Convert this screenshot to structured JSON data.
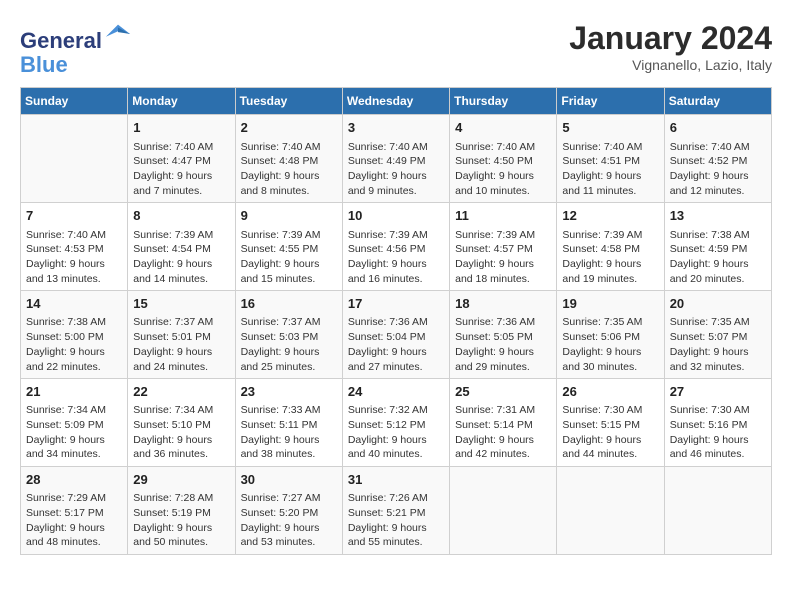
{
  "header": {
    "logo_line1": "General",
    "logo_line2": "Blue",
    "month": "January 2024",
    "location": "Vignanello, Lazio, Italy"
  },
  "weekdays": [
    "Sunday",
    "Monday",
    "Tuesday",
    "Wednesday",
    "Thursday",
    "Friday",
    "Saturday"
  ],
  "weeks": [
    [
      {
        "day": "",
        "content": ""
      },
      {
        "day": "1",
        "content": "Sunrise: 7:40 AM\nSunset: 4:47 PM\nDaylight: 9 hours\nand 7 minutes."
      },
      {
        "day": "2",
        "content": "Sunrise: 7:40 AM\nSunset: 4:48 PM\nDaylight: 9 hours\nand 8 minutes."
      },
      {
        "day": "3",
        "content": "Sunrise: 7:40 AM\nSunset: 4:49 PM\nDaylight: 9 hours\nand 9 minutes."
      },
      {
        "day": "4",
        "content": "Sunrise: 7:40 AM\nSunset: 4:50 PM\nDaylight: 9 hours\nand 10 minutes."
      },
      {
        "day": "5",
        "content": "Sunrise: 7:40 AM\nSunset: 4:51 PM\nDaylight: 9 hours\nand 11 minutes."
      },
      {
        "day": "6",
        "content": "Sunrise: 7:40 AM\nSunset: 4:52 PM\nDaylight: 9 hours\nand 12 minutes."
      }
    ],
    [
      {
        "day": "7",
        "content": "Sunrise: 7:40 AM\nSunset: 4:53 PM\nDaylight: 9 hours\nand 13 minutes."
      },
      {
        "day": "8",
        "content": "Sunrise: 7:39 AM\nSunset: 4:54 PM\nDaylight: 9 hours\nand 14 minutes."
      },
      {
        "day": "9",
        "content": "Sunrise: 7:39 AM\nSunset: 4:55 PM\nDaylight: 9 hours\nand 15 minutes."
      },
      {
        "day": "10",
        "content": "Sunrise: 7:39 AM\nSunset: 4:56 PM\nDaylight: 9 hours\nand 16 minutes."
      },
      {
        "day": "11",
        "content": "Sunrise: 7:39 AM\nSunset: 4:57 PM\nDaylight: 9 hours\nand 18 minutes."
      },
      {
        "day": "12",
        "content": "Sunrise: 7:39 AM\nSunset: 4:58 PM\nDaylight: 9 hours\nand 19 minutes."
      },
      {
        "day": "13",
        "content": "Sunrise: 7:38 AM\nSunset: 4:59 PM\nDaylight: 9 hours\nand 20 minutes."
      }
    ],
    [
      {
        "day": "14",
        "content": "Sunrise: 7:38 AM\nSunset: 5:00 PM\nDaylight: 9 hours\nand 22 minutes."
      },
      {
        "day": "15",
        "content": "Sunrise: 7:37 AM\nSunset: 5:01 PM\nDaylight: 9 hours\nand 24 minutes."
      },
      {
        "day": "16",
        "content": "Sunrise: 7:37 AM\nSunset: 5:03 PM\nDaylight: 9 hours\nand 25 minutes."
      },
      {
        "day": "17",
        "content": "Sunrise: 7:36 AM\nSunset: 5:04 PM\nDaylight: 9 hours\nand 27 minutes."
      },
      {
        "day": "18",
        "content": "Sunrise: 7:36 AM\nSunset: 5:05 PM\nDaylight: 9 hours\nand 29 minutes."
      },
      {
        "day": "19",
        "content": "Sunrise: 7:35 AM\nSunset: 5:06 PM\nDaylight: 9 hours\nand 30 minutes."
      },
      {
        "day": "20",
        "content": "Sunrise: 7:35 AM\nSunset: 5:07 PM\nDaylight: 9 hours\nand 32 minutes."
      }
    ],
    [
      {
        "day": "21",
        "content": "Sunrise: 7:34 AM\nSunset: 5:09 PM\nDaylight: 9 hours\nand 34 minutes."
      },
      {
        "day": "22",
        "content": "Sunrise: 7:34 AM\nSunset: 5:10 PM\nDaylight: 9 hours\nand 36 minutes."
      },
      {
        "day": "23",
        "content": "Sunrise: 7:33 AM\nSunset: 5:11 PM\nDaylight: 9 hours\nand 38 minutes."
      },
      {
        "day": "24",
        "content": "Sunrise: 7:32 AM\nSunset: 5:12 PM\nDaylight: 9 hours\nand 40 minutes."
      },
      {
        "day": "25",
        "content": "Sunrise: 7:31 AM\nSunset: 5:14 PM\nDaylight: 9 hours\nand 42 minutes."
      },
      {
        "day": "26",
        "content": "Sunrise: 7:30 AM\nSunset: 5:15 PM\nDaylight: 9 hours\nand 44 minutes."
      },
      {
        "day": "27",
        "content": "Sunrise: 7:30 AM\nSunset: 5:16 PM\nDaylight: 9 hours\nand 46 minutes."
      }
    ],
    [
      {
        "day": "28",
        "content": "Sunrise: 7:29 AM\nSunset: 5:17 PM\nDaylight: 9 hours\nand 48 minutes."
      },
      {
        "day": "29",
        "content": "Sunrise: 7:28 AM\nSunset: 5:19 PM\nDaylight: 9 hours\nand 50 minutes."
      },
      {
        "day": "30",
        "content": "Sunrise: 7:27 AM\nSunset: 5:20 PM\nDaylight: 9 hours\nand 53 minutes."
      },
      {
        "day": "31",
        "content": "Sunrise: 7:26 AM\nSunset: 5:21 PM\nDaylight: 9 hours\nand 55 minutes."
      },
      {
        "day": "",
        "content": ""
      },
      {
        "day": "",
        "content": ""
      },
      {
        "day": "",
        "content": ""
      }
    ]
  ]
}
